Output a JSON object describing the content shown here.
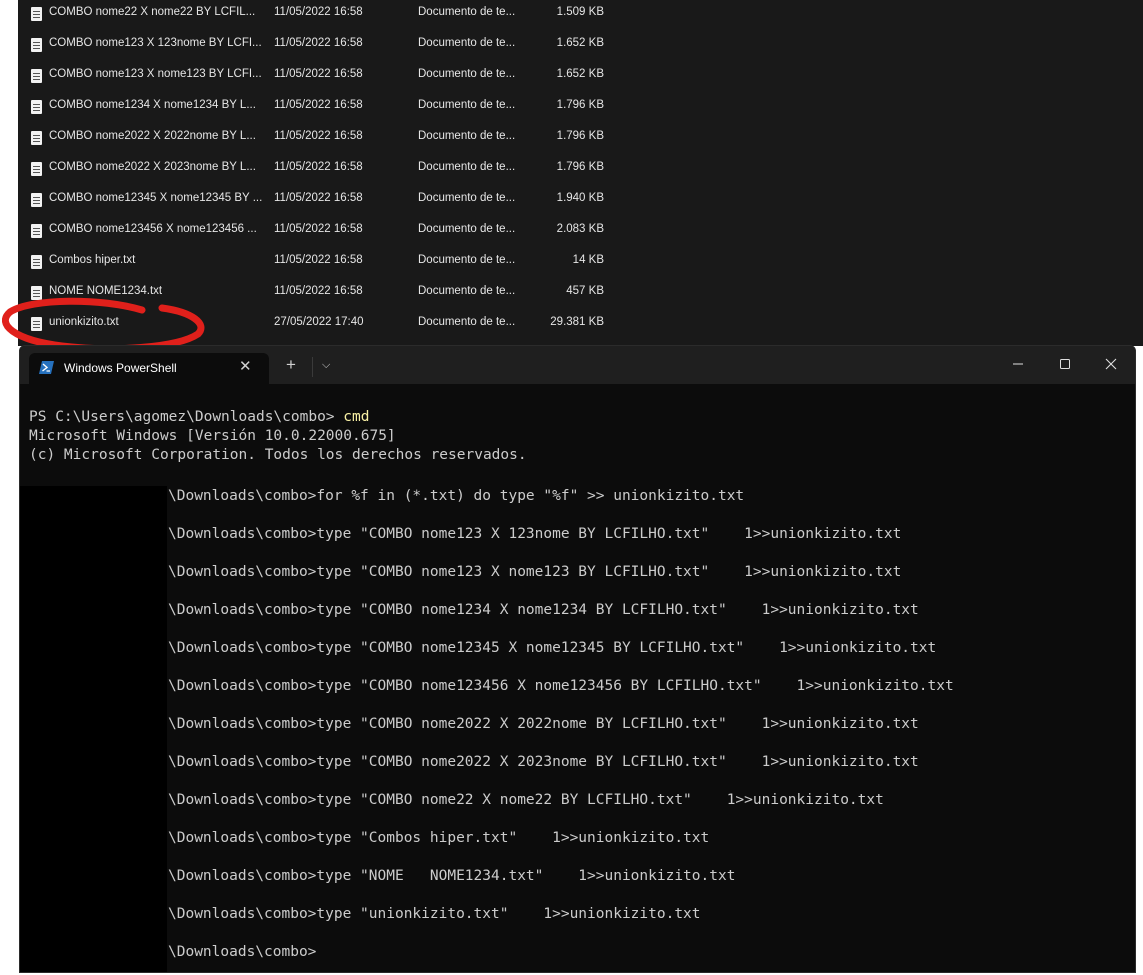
{
  "explorer": {
    "files": [
      {
        "name": "COMBO nome22 X nome22 BY LCFIL...",
        "date": "11/05/2022 16:58",
        "type": "Documento de te...",
        "size": "1.509 KB"
      },
      {
        "name": "COMBO nome123 X 123nome BY LCFI...",
        "date": "11/05/2022 16:58",
        "type": "Documento de te...",
        "size": "1.652 KB"
      },
      {
        "name": "COMBO nome123 X nome123 BY LCFI...",
        "date": "11/05/2022 16:58",
        "type": "Documento de te...",
        "size": "1.652 KB"
      },
      {
        "name": "COMBO nome1234 X nome1234 BY L...",
        "date": "11/05/2022 16:58",
        "type": "Documento de te...",
        "size": "1.796 KB"
      },
      {
        "name": "COMBO nome2022 X 2022nome BY L...",
        "date": "11/05/2022 16:58",
        "type": "Documento de te...",
        "size": "1.796 KB"
      },
      {
        "name": "COMBO nome2022 X 2023nome BY L...",
        "date": "11/05/2022 16:58",
        "type": "Documento de te...",
        "size": "1.796 KB"
      },
      {
        "name": "COMBO nome12345 X nome12345 BY ...",
        "date": "11/05/2022 16:58",
        "type": "Documento de te...",
        "size": "1.940 KB"
      },
      {
        "name": "COMBO nome123456 X nome123456 ...",
        "date": "11/05/2022 16:58",
        "type": "Documento de te...",
        "size": "2.083 KB"
      },
      {
        "name": "Combos hiper.txt",
        "date": "11/05/2022 16:58",
        "type": "Documento de te...",
        "size": "14 KB"
      },
      {
        "name": "NOME   NOME1234.txt",
        "date": "11/05/2022 16:58",
        "type": "Documento de te...",
        "size": "457 KB"
      },
      {
        "name": "unionkizito.txt",
        "date": "27/05/2022 17:40",
        "type": "Documento de te...",
        "size": "29.381 KB"
      }
    ]
  },
  "terminal": {
    "tab_title": "Windows PowerShell",
    "tab_icon": "powershell-icon",
    "new_tab_symbol": "+",
    "dropdown_symbol": "⌵",
    "close_tab_symbol": "✕",
    "prompt_ps": "PS C:\\Users\\agomez\\Downloads\\combo> ",
    "first_command": "cmd",
    "banner_line1": "Microsoft Windows [Versión 10.0.22000.675]",
    "banner_line2": "(c) Microsoft Corporation. Todos los derechos reservados.",
    "lines": [
      "\\Downloads\\combo>for %f in (*.txt) do type \"%f\" >> unionkizito.txt",
      "\\Downloads\\combo>type \"COMBO nome123 X 123nome BY LCFILHO.txt\"    1>>unionkizito.txt",
      "\\Downloads\\combo>type \"COMBO nome123 X nome123 BY LCFILHO.txt\"    1>>unionkizito.txt",
      "\\Downloads\\combo>type \"COMBO nome1234 X nome1234 BY LCFILHO.txt\"    1>>unionkizito.txt",
      "\\Downloads\\combo>type \"COMBO nome12345 X nome12345 BY LCFILHO.txt\"    1>>unionkizito.txt",
      "\\Downloads\\combo>type \"COMBO nome123456 X nome123456 BY LCFILHO.txt\"    1>>unionkizito.txt",
      "\\Downloads\\combo>type \"COMBO nome2022 X 2022nome BY LCFILHO.txt\"    1>>unionkizito.txt",
      "\\Downloads\\combo>type \"COMBO nome2022 X 2023nome BY LCFILHO.txt\"    1>>unionkizito.txt",
      "\\Downloads\\combo>type \"COMBO nome22 X nome22 BY LCFILHO.txt\"    1>>unionkizito.txt",
      "\\Downloads\\combo>type \"Combos hiper.txt\"    1>>unionkizito.txt",
      "\\Downloads\\combo>type \"NOME   NOME1234.txt\"    1>>unionkizito.txt",
      "\\Downloads\\combo>type \"unionkizito.txt\"    1>>unionkizito.txt",
      "\\Downloads\\combo>"
    ]
  },
  "colors": {
    "explorer_bg": "#191919",
    "terminal_bg": "#0c0c0c",
    "titlebar_bg": "#1f1f1f",
    "command_highlight": "#f9f1a5",
    "annotation_red": "#e0201b"
  }
}
